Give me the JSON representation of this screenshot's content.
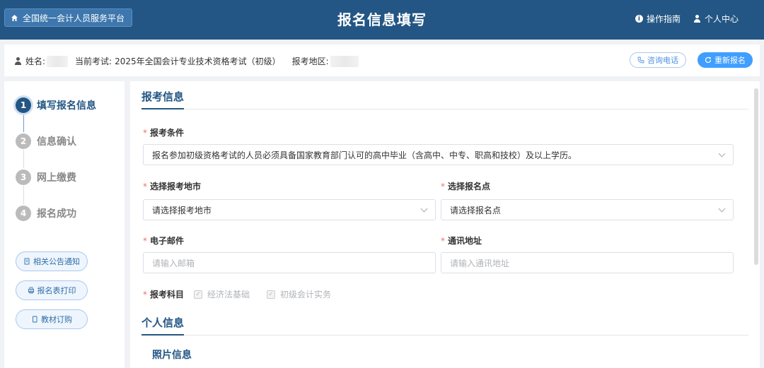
{
  "header": {
    "home_label": "全国统一会计人员服务平台",
    "title": "报名信息填写",
    "guide_label": "操作指南",
    "user_center_label": "个人中心"
  },
  "infobar": {
    "name_label": "姓名:",
    "exam_label": "当前考试:",
    "exam_value": "2025年全国会计专业技术资格考试（初级）",
    "region_label": "报考地区:",
    "consult_label": "咨询电话",
    "reapply_label": "重新报名"
  },
  "steps": [
    {
      "num": "1",
      "label": "填写报名信息",
      "active": true
    },
    {
      "num": "2",
      "label": "信息确认",
      "active": false
    },
    {
      "num": "3",
      "label": "网上缴费",
      "active": false
    },
    {
      "num": "4",
      "label": "报名成功",
      "active": false
    }
  ],
  "side_buttons": {
    "notice": "相关公告通知",
    "print": "报名表打印",
    "textbook": "教材订购"
  },
  "form": {
    "section_exam": "报考信息",
    "condition_label": "报考条件",
    "condition_value": "报名参加初级资格考试的人员必须具备国家教育部门认可的高中毕业（含高中、中专、职高和技校）及以上学历。",
    "city_label": "选择报考地市",
    "city_placeholder": "请选择报考地市",
    "site_label": "选择报名点",
    "site_placeholder": "请选择报名点",
    "email_label": "电子邮件",
    "email_placeholder": "请输入邮箱",
    "address_label": "通讯地址",
    "address_placeholder": "请输入通讯地址",
    "subjects_label": "报考科目",
    "subjects": [
      "经济法基础",
      "初级会计实务"
    ],
    "section_personal": "个人信息",
    "photo_title": "照片信息"
  },
  "colors": {
    "header_bg": "#235684",
    "accent": "#409eff",
    "required": "#f56c6c"
  }
}
